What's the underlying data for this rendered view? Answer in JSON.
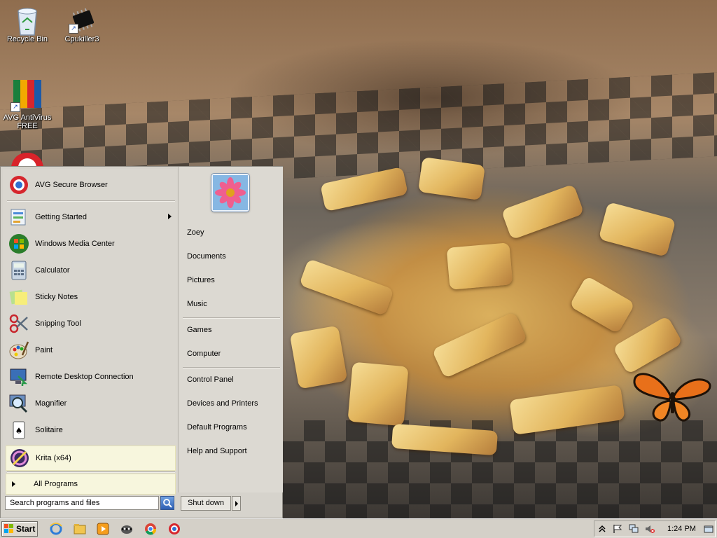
{
  "desktop": {
    "icons": [
      {
        "label": "Recycle Bin",
        "icon": "recycle-bin-icon"
      },
      {
        "label": "Cpukiller3",
        "icon": "chip-icon"
      },
      {
        "label": "AVG AntiVirus FREE",
        "icon": "avg-icon"
      }
    ]
  },
  "start_menu": {
    "pinned": {
      "label": "AVG Secure Browser",
      "icon": "avg-browser-icon"
    },
    "programs": [
      {
        "label": "Getting Started",
        "icon": "getting-started-icon",
        "has_submenu": true
      },
      {
        "label": "Windows Media Center",
        "icon": "media-center-icon"
      },
      {
        "label": "Calculator",
        "icon": "calculator-icon"
      },
      {
        "label": "Sticky Notes",
        "icon": "sticky-notes-icon"
      },
      {
        "label": "Snipping Tool",
        "icon": "scissors-icon"
      },
      {
        "label": "Paint",
        "icon": "paint-palette-icon"
      },
      {
        "label": "Remote Desktop Connection",
        "icon": "remote-desktop-icon"
      },
      {
        "label": "Magnifier",
        "icon": "magnifier-icon"
      },
      {
        "label": "Solitaire",
        "icon": "cards-icon"
      },
      {
        "label": "Krita (x64)",
        "icon": "krita-icon",
        "highlighted": true
      }
    ],
    "all_programs": "All Programs",
    "search_placeholder": "Search programs and files",
    "right_items_group1": [
      "Zoey",
      "Documents",
      "Pictures",
      "Music"
    ],
    "right_items_group2": [
      "Games",
      "Computer"
    ],
    "right_items_group3": [
      "Control Panel",
      "Devices and Printers",
      "Default Programs",
      "Help and Support"
    ],
    "shutdown_label": "Shut down"
  },
  "taskbar": {
    "start_label": "Start",
    "pinned_icons": [
      "internet-explorer-icon",
      "file-explorer-icon",
      "media-player-icon",
      "raccoon-app-icon",
      "chrome-icon",
      "avg-browser-icon"
    ],
    "tray": {
      "icons": [
        "show-hidden-icons-chevron",
        "action-center-flag-icon",
        "network-icon",
        "volume-muted-icon"
      ],
      "clock": "1:24 PM"
    }
  },
  "colors": {
    "menu_bg": "#d6d3cc",
    "highlight": "#f7f6dd",
    "taskbar_bg": "#d4d0c8"
  }
}
